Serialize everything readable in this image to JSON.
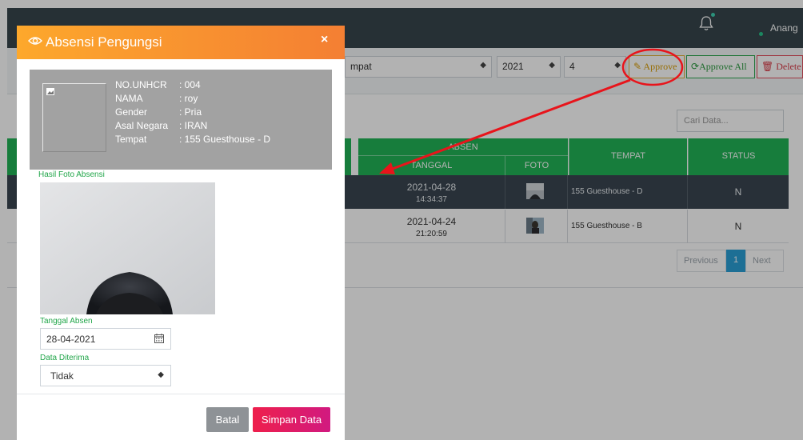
{
  "topbar": {
    "user_name": "Anang",
    "icon": "bell-icon"
  },
  "filters": {
    "tempat_value": "mpat",
    "year_value": "2021",
    "month_value": "4",
    "approve_label": "Approve",
    "approve_all_label": "Approve All",
    "delete_label": "Delete"
  },
  "search": {
    "placeholder": "Cari Data..."
  },
  "table": {
    "group_header": "ABSEN",
    "headers": {
      "tanggal": "TANGGAL",
      "foto": "FOTO",
      "tempat": "TEMPAT",
      "status": "STATUS"
    },
    "rows": [
      {
        "date": "2021-04-28",
        "time": "14:34:37",
        "tempat": "155 Guesthouse - D",
        "status": "N"
      },
      {
        "date": "2021-04-24",
        "time": "21:20:59",
        "tempat": "155 Guesthouse - B",
        "status": "N"
      }
    ]
  },
  "pagination": {
    "previous": "Previous",
    "current": "1",
    "next": "Next"
  },
  "modal": {
    "title": "Absensi Pengungsi",
    "close": "×",
    "info": [
      {
        "key": "NO.UNHCR",
        "value": ": 004"
      },
      {
        "key": "NAMA",
        "value": ": roy"
      },
      {
        "key": "Gender",
        "value": ": Pria"
      },
      {
        "key": "Asal Negara",
        "value": ": IRAN"
      },
      {
        "key": "Tempat",
        "value": ": 155 Guesthouse - D"
      }
    ],
    "photo_label": "Hasil Foto Absensi",
    "date_label": "Tanggal Absen",
    "date_value": "28-04-2021",
    "accepted_label": "Data Diterima",
    "accepted_value": "Tidak",
    "cancel_label": "Batal",
    "save_label": "Simpan Data"
  },
  "colors": {
    "topbar": "#37464d",
    "header_green": "#22b456",
    "modal_header_start": "#fda82c",
    "modal_header_end": "#f47f33",
    "save_start": "#ee1f4c",
    "save_end": "#d11a80",
    "annotation_red": "#e8141b"
  }
}
